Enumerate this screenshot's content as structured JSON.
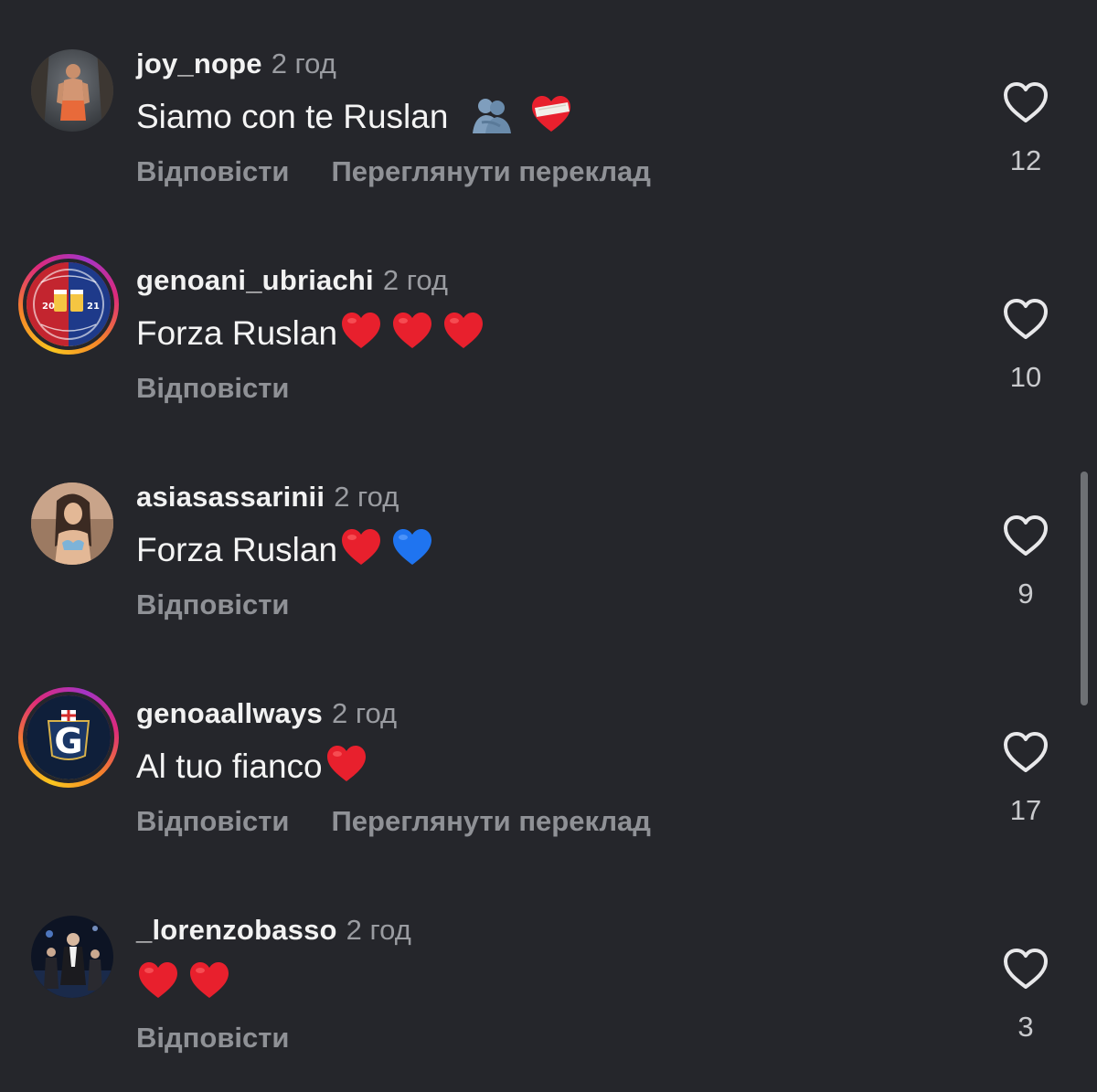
{
  "colors": {
    "background": "#25262b",
    "username": "#f2f2f2",
    "time": "#9a9ca1",
    "action": "#8f9196",
    "heart_red": "#e8202d",
    "heart_blue": "#1f74f0"
  },
  "comments": [
    {
      "username": "joy_nope",
      "time": "2 год",
      "text": "Siamo con te Ruslan",
      "emojis": [
        "people-hugging-emoji",
        "mending-heart-emoji"
      ],
      "reply_label": "Відповісти",
      "translate_label": "Переглянути переклад",
      "likes": "12",
      "avatar": "photo-avatar-beach",
      "story_ring": false
    },
    {
      "username": "genoani_ubriachi",
      "time": "2 год",
      "text": "Forza Ruslan",
      "emojis": [
        "red-heart-emoji",
        "red-heart-emoji",
        "red-heart-emoji"
      ],
      "reply_label": "Відповісти",
      "likes": "10",
      "avatar": "club-logo-avatar",
      "avatar_text": [
        "20",
        "21"
      ],
      "story_ring": true
    },
    {
      "username": "asiasassarinii",
      "time": "2 год",
      "text": "Forza Ruslan",
      "emojis": [
        "red-heart-emoji",
        "blue-heart-emoji"
      ],
      "reply_label": "Відповісти",
      "likes": "9",
      "avatar": "photo-avatar-woman",
      "story_ring": false
    },
    {
      "username": "genoaallways",
      "time": "2 год",
      "text": "Al tuo fianco",
      "emojis": [
        "red-heart-emoji"
      ],
      "reply_label": "Відповісти",
      "translate_label": "Переглянути переклад",
      "likes": "17",
      "avatar": "g-logo-avatar",
      "avatar_text": [
        "G"
      ],
      "story_ring": true
    },
    {
      "username": "_lorenzobasso",
      "time": "2 год",
      "text": "",
      "emojis": [
        "red-heart-emoji",
        "red-heart-emoji"
      ],
      "reply_label": "Відповісти",
      "likes": "3",
      "avatar": "photo-avatar-night",
      "story_ring": false
    }
  ]
}
